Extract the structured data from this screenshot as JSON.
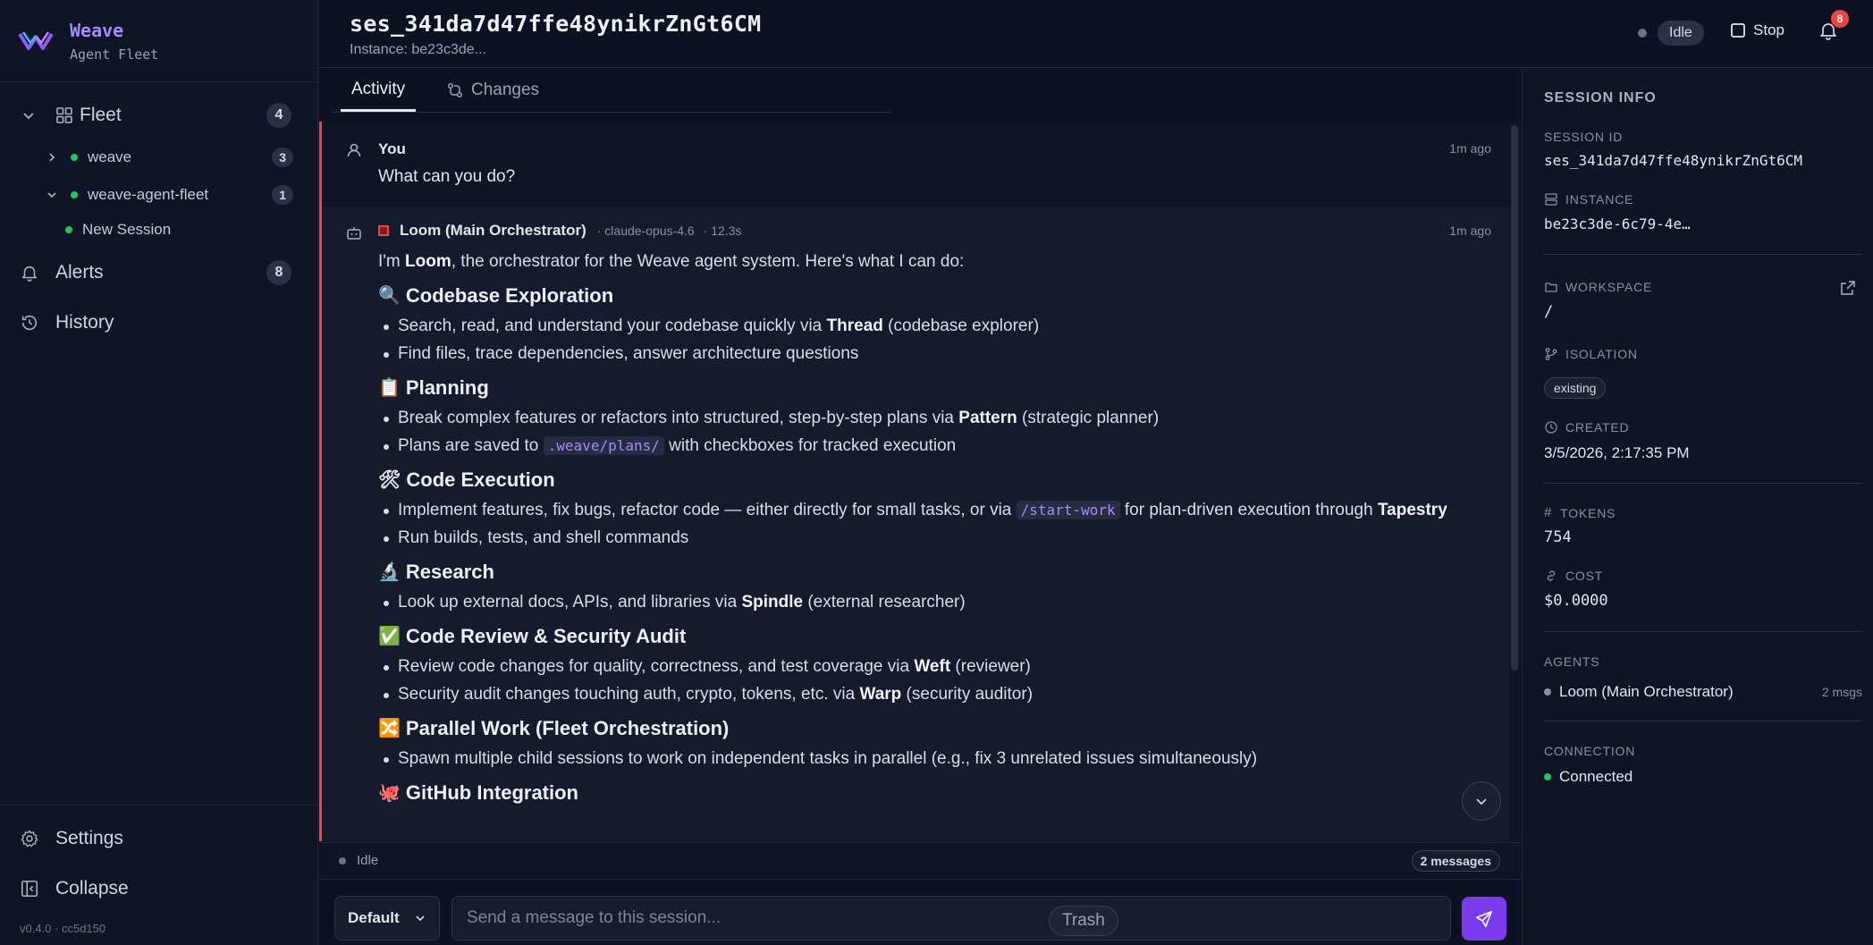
{
  "sidebar": {
    "brand_title": "Weave",
    "brand_subtitle": "Agent Fleet",
    "fleet_label": "Fleet",
    "fleet_count": "4",
    "projects": [
      {
        "label": "weave",
        "count": "3"
      },
      {
        "label": "weave-agent-fleet",
        "count": "1"
      }
    ],
    "new_session_label": "New Session",
    "alerts_label": "Alerts",
    "alerts_count": "8",
    "history_label": "History",
    "settings_label": "Settings",
    "collapse_label": "Collapse",
    "version": "v0.4.0 · cc5d150"
  },
  "header": {
    "session_title": "ses_341da7d47ffe48ynikrZnGt6CM",
    "instance_line": "Instance: be23c3de...",
    "status": "Idle",
    "stop_label": "Stop",
    "notifications_count": "8"
  },
  "tabs": [
    {
      "label": "Activity",
      "active": true
    },
    {
      "label": "Changes",
      "active": false
    }
  ],
  "messages": {
    "user": {
      "name": "You",
      "time": "1m ago",
      "text": "What can you do?"
    },
    "bot": {
      "name": "Loom (Main Orchestrator)",
      "model": "· claude-opus-4.6",
      "duration": "· 12.3s",
      "time": "1m ago",
      "intro_pre": "I'm ",
      "intro_bold": "Loom",
      "intro_post": ", the orchestrator for the Weave agent system. Here's what I can do:",
      "sections": [
        {
          "emoji": "🔍",
          "title": "Codebase Exploration"
        },
        {
          "emoji": "📋",
          "title": "Planning"
        },
        {
          "emoji": "🛠",
          "title": "Code Execution"
        },
        {
          "emoji": "🔬",
          "title": "Research"
        },
        {
          "emoji": "✅",
          "title": "Code Review & Security Audit"
        },
        {
          "emoji": "🔀",
          "title": "Parallel Work (Fleet Orchestration)"
        },
        {
          "emoji": "🐙",
          "title": "GitHub Integration"
        }
      ],
      "items": {
        "s1a_pre": "Search, read, and understand your codebase quickly via ",
        "s1a_bold": "Thread",
        "s1a_post": " (codebase explorer)",
        "s1b": "Find files, trace dependencies, answer architecture questions",
        "s2a_pre": "Break complex features or refactors into structured, step-by-step plans via ",
        "s2a_bold": "Pattern",
        "s2a_post": " (strategic planner)",
        "s2b_pre": "Plans are saved to ",
        "s2b_code": ".weave/plans/",
        "s2b_post": " with checkboxes for tracked execution",
        "s3a_pre": "Implement features, fix bugs, refactor code — either directly for small tasks, or via ",
        "s3a_code": "/start-work",
        "s3a_post": " for plan-driven execution through ",
        "s3a_bold": "Tapestry",
        "s3b": "Run builds, tests, and shell commands",
        "s4a_pre": "Look up external docs, APIs, and libraries via ",
        "s4a_bold": "Spindle",
        "s4a_post": " (external researcher)",
        "s5a_pre": "Review code changes for quality, correctness, and test coverage via ",
        "s5a_bold": "Weft",
        "s5a_post": " (reviewer)",
        "s5b_pre": "Security audit changes touching auth, crypto, tokens, etc. via ",
        "s5b_bold": "Warp",
        "s5b_post": " (security auditor)",
        "s6a": "Spawn multiple child sessions to work on independent tasks in parallel (e.g., fix 3 unrelated issues simultaneously)"
      }
    }
  },
  "status_bar": {
    "status": "Idle",
    "message_count": "2 messages"
  },
  "composer": {
    "agent_select": "Default",
    "placeholder": "Send a message to this session...",
    "tooltip": "Trash"
  },
  "info": {
    "title": "SESSION INFO",
    "session_id_label": "SESSION ID",
    "session_id": "ses_341da7d47ffe48ynikrZnGt6CM",
    "instance_label": "INSTANCE",
    "instance": "be23c3de-6c79-4e…",
    "workspace_label": "WORKSPACE",
    "workspace": "/",
    "isolation_label": "ISOLATION",
    "isolation": "existing",
    "created_label": "CREATED",
    "created": "3/5/2026, 2:17:35 PM",
    "tokens_label": "TOKENS",
    "tokens": "754",
    "cost_label": "COST",
    "cost": "$0.0000",
    "agents_label": "AGENTS",
    "agent_name": "Loom (Main Orchestrator)",
    "agent_msgs": "2 msgs",
    "connection_label": "CONNECTION",
    "connection": "Connected"
  },
  "colors": {
    "accent": "#7c3aed",
    "brand": "#a78bfa",
    "alert": "#ef4444",
    "online": "#22c55e"
  }
}
